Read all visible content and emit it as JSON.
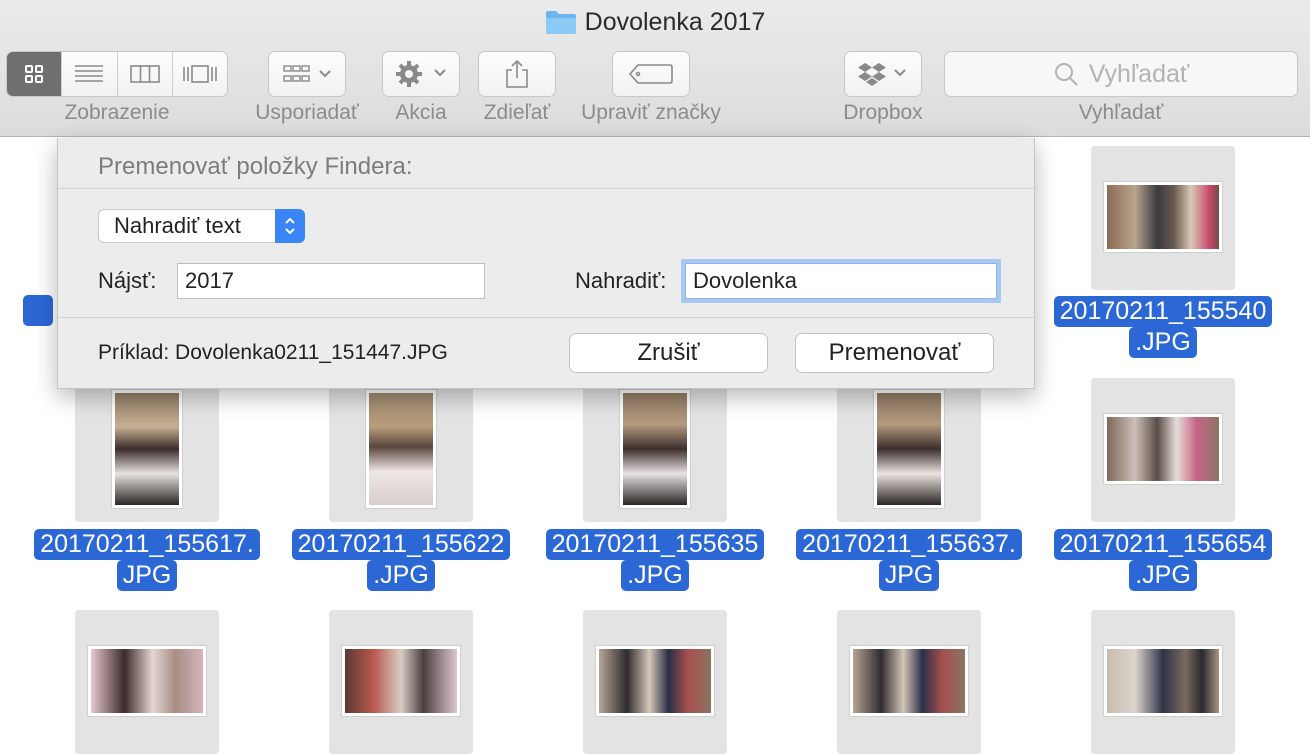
{
  "window": {
    "title": "Dovolenka 2017",
    "folder_icon": "folder-icon"
  },
  "toolbar": {
    "view_label": "Zobrazenie",
    "arrange_label": "Usporiadať",
    "action_label": "Akcia",
    "share_label": "Zdieľať",
    "tags_label": "Upraviť značky",
    "dropbox_label": "Dropbox",
    "search_label": "Vyhľadať",
    "search_placeholder": "Vyhľadať"
  },
  "files": [
    {
      "name_line1": "20170211_155540",
      "name_line2": ".JPG",
      "orientation": "landscape"
    },
    {
      "name_line1": "20170211_155617.",
      "name_line2": "JPG",
      "orientation": "portrait"
    },
    {
      "name_line1": "20170211_155622",
      "name_line2": ".JPG",
      "orientation": "portrait"
    },
    {
      "name_line1": "20170211_155635",
      "name_line2": ".JPG",
      "orientation": "portrait"
    },
    {
      "name_line1": "20170211_155637.",
      "name_line2": "JPG",
      "orientation": "portrait"
    },
    {
      "name_line1": "20170211_155654",
      "name_line2": ".JPG",
      "orientation": "landscape"
    }
  ],
  "rename_sheet": {
    "title": "Premenovať položky Findera:",
    "mode": "Nahradiť text",
    "find_label": "Nájsť:",
    "find_value": "2017",
    "replace_label": "Nahradiť:",
    "replace_value": "Dovolenka",
    "example": "Príklad: Dovolenka0211_151447.JPG",
    "cancel_label": "Zrušiť",
    "rename_label": "Premenovať"
  },
  "colors": {
    "selection": "#2b68d6",
    "focus_ring": "#a9c7f3",
    "accent": "#3b86f7"
  }
}
